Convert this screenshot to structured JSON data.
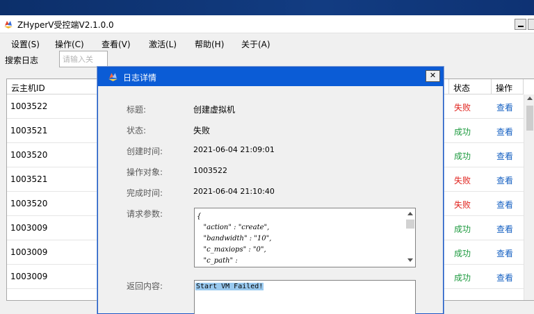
{
  "app": {
    "title": "ZHyperV受控端V2.1.0.0",
    "menu": [
      "设置(S)",
      "操作(C)",
      "查看(V)",
      "激活(L)",
      "帮助(H)",
      "关于(A)"
    ]
  },
  "search": {
    "label": "搜索日志",
    "placeholder": "请输入关"
  },
  "table": {
    "columns": [
      "云主机ID",
      "状态",
      "操作"
    ],
    "rows": [
      {
        "id": "1003522",
        "status": "失败",
        "action": "查看"
      },
      {
        "id": "1003521",
        "status": "成功",
        "action": "查看"
      },
      {
        "id": "1003520",
        "status": "成功",
        "action": "查看"
      },
      {
        "id": "1003521",
        "status": "失败",
        "action": "查看"
      },
      {
        "id": "1003520",
        "status": "失败",
        "action": "查看"
      },
      {
        "id": "1003009",
        "status": "成功",
        "action": "查看"
      },
      {
        "id": "1003009",
        "status": "成功",
        "action": "查看"
      },
      {
        "id": "1003009",
        "status": "成功",
        "action": "查看"
      }
    ]
  },
  "dialog": {
    "title": "日志详情",
    "close": "✕",
    "fields": [
      {
        "label": "标题:",
        "value": "创建虚拟机"
      },
      {
        "label": "状态:",
        "value": "失败"
      },
      {
        "label": "创建时间:",
        "value": "2021-06-04 21:09:01"
      },
      {
        "label": "操作对象:",
        "value": "1003522"
      },
      {
        "label": "完成时间:",
        "value": "2021-06-04 21:10:40"
      }
    ],
    "params_label": "请求参数:",
    "params_lines": [
      "{",
      "   \"action\" : \"create\",",
      "   \"bandwidth\" : \"10\",",
      "   \"c_maxiops\" : \"0\",",
      "   \"c_path\" :"
    ],
    "response_label": "返回内容:",
    "response": "Start VM Failed!"
  },
  "colors": {
    "fail": "#e0201b",
    "success": "#1d9a3f",
    "link": "#1560c2",
    "dialog_titlebar": "#0b5cd6"
  }
}
